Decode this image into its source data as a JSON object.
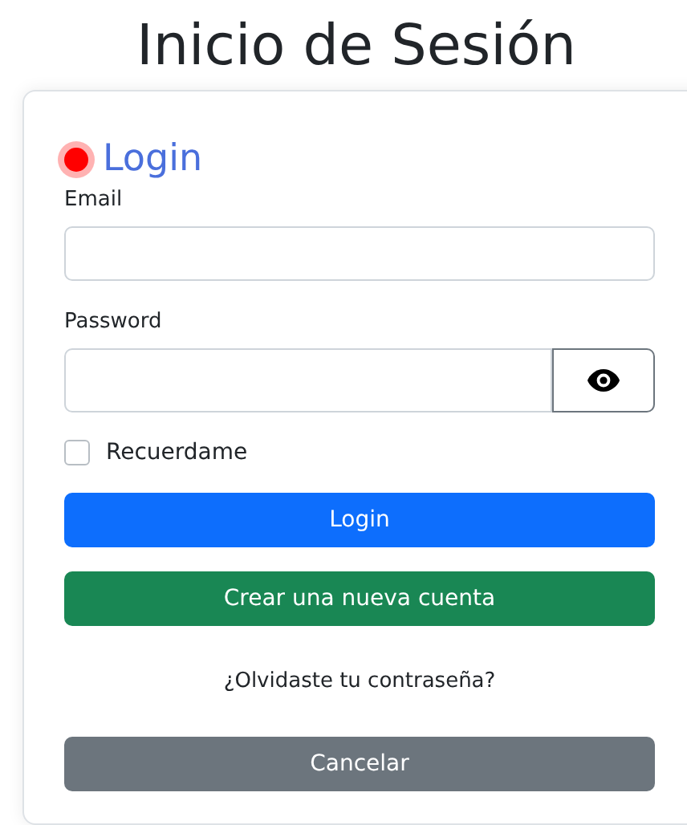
{
  "page_title": "Inicio de Sesión",
  "card": {
    "status_dot": {
      "color": "#ff0000"
    },
    "heading": "Login",
    "fields": [
      {
        "label": "Email",
        "kind": "text"
      },
      {
        "label": "Password",
        "kind": "password"
      }
    ],
    "remember": {
      "label": "Recuerdame",
      "checked": false
    },
    "buttons": [
      {
        "label": "Login",
        "kind": "primary"
      },
      {
        "label": "Crear una nueva cuenta",
        "kind": "success"
      }
    ],
    "forgot_link": "¿Olvidaste tu contraseña?",
    "cancel": {
      "label": "Cancelar",
      "kind": "secondary"
    }
  }
}
